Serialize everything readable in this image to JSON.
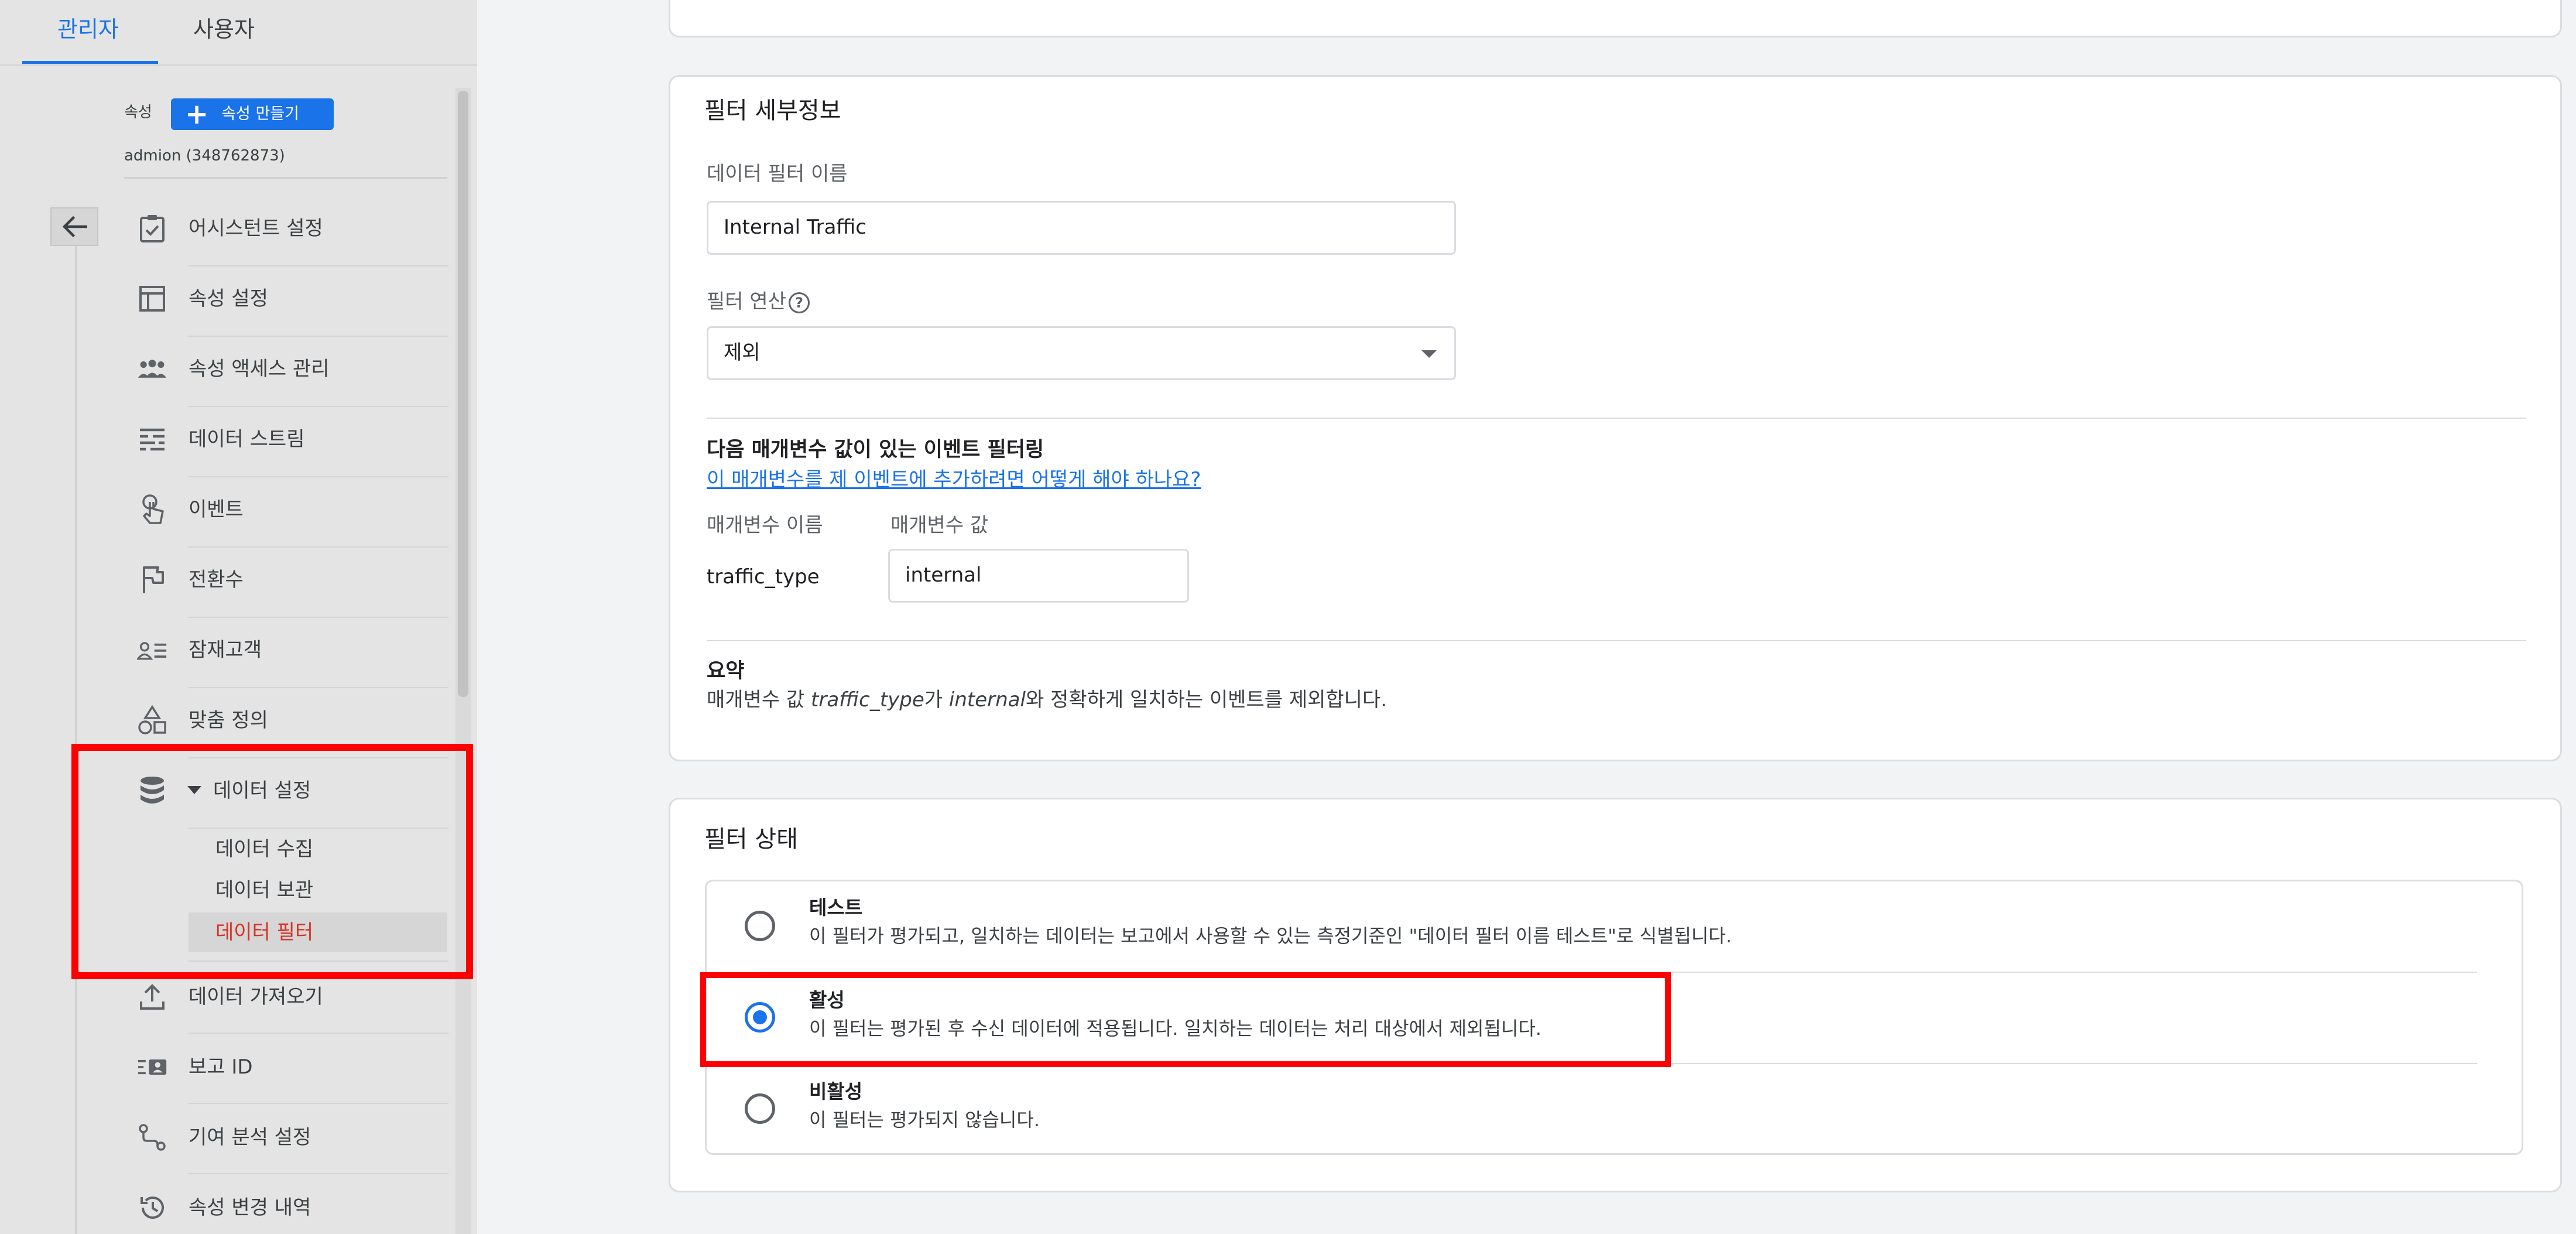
{
  "colors": {
    "accent": "#1a73e8",
    "selected_text": "#d93025",
    "highlight_box": "#ff0000"
  },
  "tabs": {
    "admin": "관리자",
    "user": "사용자"
  },
  "property": {
    "label": "속성",
    "create_button": "속성 만들기",
    "account": "admion (348762873)"
  },
  "sidebar": {
    "back_icon": "arrow-left-icon",
    "items": [
      {
        "label": "어시스턴트 설정",
        "icon": "checklist-icon"
      },
      {
        "label": "속성 설정",
        "icon": "window-icon"
      },
      {
        "label": "속성 액세스 관리",
        "icon": "people-icon"
      },
      {
        "label": "데이터 스트림",
        "icon": "stream-icon"
      },
      {
        "label": "이벤트",
        "icon": "touch-icon"
      },
      {
        "label": "전환수",
        "icon": "flag-icon"
      },
      {
        "label": "잠재고객",
        "icon": "audience-icon"
      },
      {
        "label": "맞춤 정의",
        "icon": "shapes-icon"
      },
      {
        "label": "데이터 설정",
        "icon": "database-icon",
        "expanded": true
      },
      {
        "label": "데이터 가져오기",
        "icon": "upload-icon"
      },
      {
        "label": "보고 ID",
        "icon": "report-id-icon"
      },
      {
        "label": "기여 분석 설정",
        "icon": "attribution-icon"
      },
      {
        "label": "속성 변경 내역",
        "icon": "history-icon"
      }
    ],
    "sub_items": [
      "데이터 수집",
      "데이터 보관",
      "데이터 필터"
    ],
    "selected_sub_item": "데이터 필터"
  },
  "details": {
    "title": "필터 세부정보",
    "name_label": "데이터 필터 이름",
    "name_value": "Internal Traffic",
    "operation_label": "필터 연산",
    "operation_value": "제외",
    "param_section_title": "다음 매개변수 값이 있는 이벤트 필터링",
    "param_help_link": "이 매개변수를 제 이벤트에 추가하려면 어떻게 해야 하나요?",
    "param_name_header": "매개변수 이름",
    "param_value_header": "매개변수 값",
    "param_name": "traffic_type",
    "param_value": "internal",
    "summary_title": "요약",
    "summary_prefix": "매개변수 값 ",
    "summary_param": "traffic_type",
    "summary_mid": "가 ",
    "summary_value": "internal",
    "summary_suffix": "와 정확하게 일치하는 이벤트를 제외합니다."
  },
  "status": {
    "title": "필터 상태",
    "selected": "활성",
    "options": [
      {
        "title": "테스트",
        "description": "이 필터가 평가되고, 일치하는 데이터는 보고에서 사용할 수 있는 측정기준인 \"데이터 필터 이름 테스트\"로 식별됩니다."
      },
      {
        "title": "활성",
        "description": "이 필터는 평가된 후 수신 데이터에 적용됩니다. 일치하는 데이터는 처리 대상에서 제외됩니다."
      },
      {
        "title": "비활성",
        "description": "이 필터는 평가되지 않습니다."
      }
    ]
  }
}
